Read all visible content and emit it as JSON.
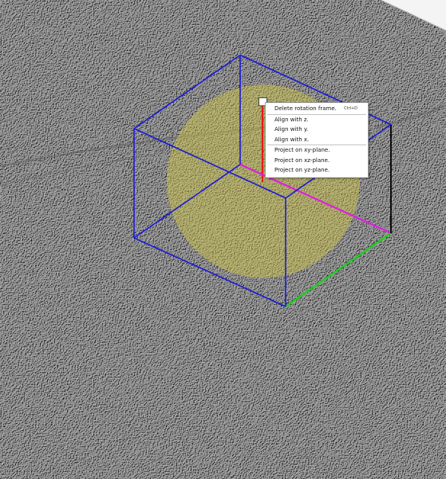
{
  "colors": {
    "box_edges": "#1a1ad8",
    "sphere_fill": "#d8cc3c",
    "x_axis": "#e81818",
    "y_axis": "#e020e0",
    "z_axis": "#20cc20",
    "extra_edge": "#000000",
    "menu_background": "#ffffff"
  },
  "context_menu": {
    "items": [
      {
        "label": "Delete rotation frame.",
        "shortcut": "Ctrl+D"
      },
      {
        "label": "Align with z."
      },
      {
        "label": "Align with y."
      },
      {
        "label": "Align with x."
      },
      {
        "label": "Project on xy-plane."
      },
      {
        "label": "Project on xz-plane."
      },
      {
        "label": "Project on yz-plane."
      }
    ]
  }
}
